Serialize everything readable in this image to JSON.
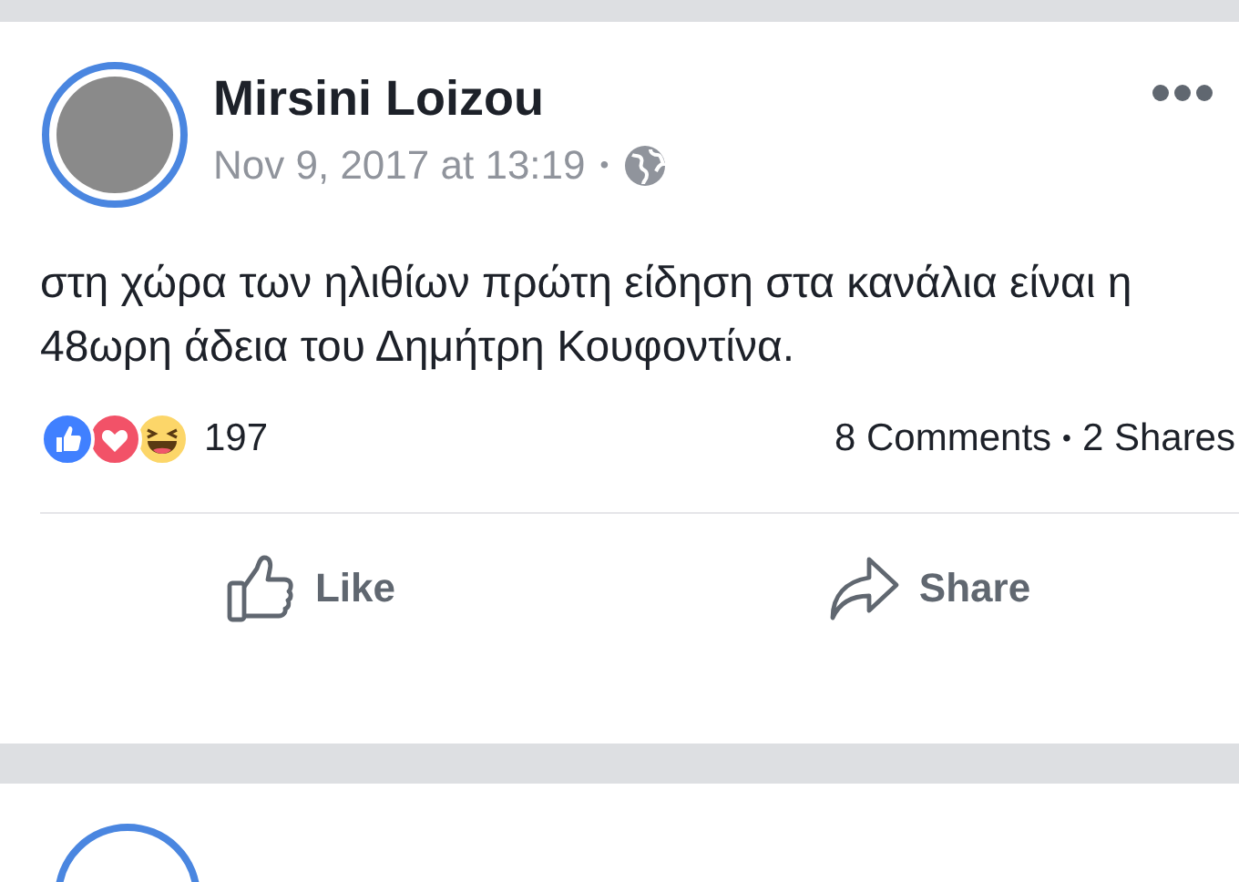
{
  "post": {
    "author": "Mirsini Loizou",
    "timestamp": "Nov 9, 2017 at 13:19",
    "separator": "•",
    "text": "στη χώρα των ηλιθίων πρώτη είδηση στα κανάλια είναι η 48ωρη άδεια του Δημήτρη Κουφοντίνα.",
    "reactions": [
      {
        "kind": "like"
      },
      {
        "kind": "love"
      },
      {
        "kind": "haha"
      }
    ],
    "reaction_count": "197",
    "comments": "8 Comments",
    "stats_separator": "•",
    "shares": "2 Shares",
    "actions": [
      {
        "kind": "like",
        "label": "Like"
      },
      {
        "kind": "share",
        "label": "Share"
      }
    ]
  }
}
